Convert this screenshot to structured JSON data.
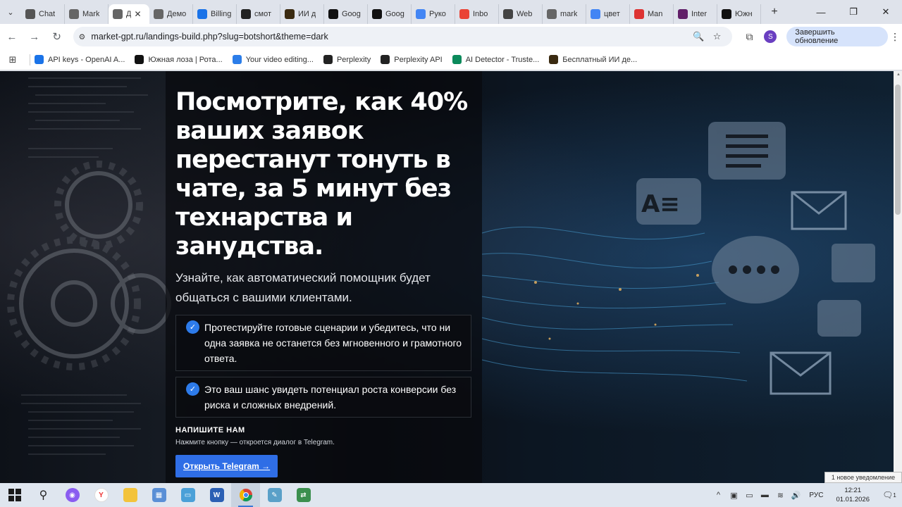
{
  "browser": {
    "tabs": [
      {
        "label": "Chat",
        "icon": "chatgpt-icon",
        "color": "#555555"
      },
      {
        "label": "Mark",
        "icon": "globe-icon",
        "color": "#666666"
      },
      {
        "label": "Д",
        "icon": "globe-icon",
        "color": "#666666",
        "active": true
      },
      {
        "label": "Демо",
        "icon": "globe-icon",
        "color": "#666666"
      },
      {
        "label": "Billing",
        "icon": "openai-icon",
        "color": "#1a73e8"
      },
      {
        "label": "смот",
        "icon": "perplexity-icon",
        "color": "#222222"
      },
      {
        "label": "ИИ д",
        "icon": "ai-detector-icon",
        "color": "#3a2a10"
      },
      {
        "label": "Goog",
        "icon": "screen-icon",
        "color": "#111111"
      },
      {
        "label": "Goog",
        "icon": "screen-icon",
        "color": "#111111"
      },
      {
        "label": "Руко",
        "icon": "google-icon",
        "color": "#4285f4"
      },
      {
        "label": "Inbo",
        "icon": "gmail-icon",
        "color": "#ea4335"
      },
      {
        "label": "Web",
        "icon": "web-icon",
        "color": "#444444"
      },
      {
        "label": "mark",
        "icon": "globe-icon",
        "color": "#666666"
      },
      {
        "label": "цвет",
        "icon": "google-icon",
        "color": "#4285f4"
      },
      {
        "label": "Man",
        "icon": "flipboard-icon",
        "color": "#d33"
      },
      {
        "label": "Inter",
        "icon": "slack-icon",
        "color": "#611f69"
      },
      {
        "label": "Южн",
        "icon": "cross-icon",
        "color": "#111111"
      }
    ],
    "close_tab_glyph": "✕",
    "new_tab_glyph": "+",
    "window_controls": {
      "minimize": "—",
      "maximize": "❐",
      "close": "✕"
    },
    "url": "market-gpt.ru/landings-build.php?slug=botshort&theme=dark",
    "update_button": "Завершить обновление",
    "profile_initial": "S",
    "bookmarks": [
      {
        "label": "API keys - OpenAI A...",
        "icon": "openai-icon",
        "color": "#1a73e8"
      },
      {
        "label": "Южная лоза | Рота...",
        "icon": "cross-icon",
        "color": "#111111"
      },
      {
        "label": "Your video editing...",
        "icon": "video-icon",
        "color": "#2b7de9"
      },
      {
        "label": "Perplexity",
        "icon": "perplexity-icon",
        "color": "#222222"
      },
      {
        "label": "Perplexity API",
        "icon": "perplexity-icon",
        "color": "#222222"
      },
      {
        "label": "AI Detector - Truste...",
        "icon": "shield-icon",
        "color": "#0b8a5b"
      },
      {
        "label": "Бесплатный ИИ де...",
        "icon": "ai-detector-icon",
        "color": "#3a2a10"
      }
    ]
  },
  "page": {
    "hero_title": "Посмотрите, как 40% ваших заявок перестанут тонуть в чате, за 5 минут без технарства и занудства.",
    "hero_subtitle": "Узнайте, как автоматический помощник будет общаться с вашими клиентами.",
    "features": [
      "Протестируйте готовые сценарии и убедитесь, что ни одна заявка не останется без мгновенного и грамотного ответа.",
      "Это ваш шанс увидеть потенциал роста конверсии без риска и сложных внедрений."
    ],
    "check_glyph": "✓",
    "contact_heading": "НАПИШИТЕ НАМ",
    "contact_note": "Нажмите кнопку — откроется диалог в Telegram.",
    "telegram_button": "Открыть Telegram →"
  },
  "os": {
    "notification_toast": "1 новое уведомление",
    "tray_language": "РУС",
    "clock_time": "12:21",
    "clock_date": "01.01.2026",
    "notification_count": "1",
    "accent": "#3a78d6"
  }
}
